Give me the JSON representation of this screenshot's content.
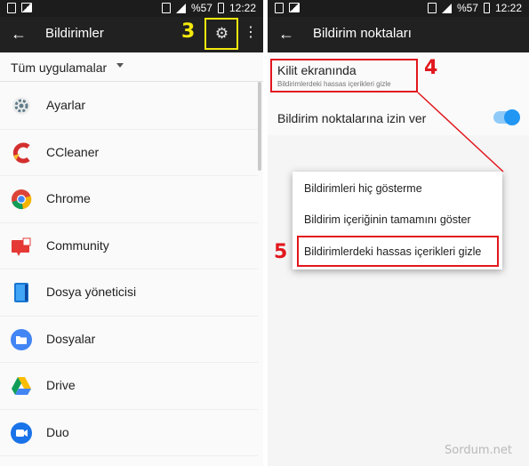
{
  "status": {
    "battery": "%57",
    "time": "12:22"
  },
  "left": {
    "title": "Bildirimler",
    "step_number": "3",
    "filter_label": "Tüm uygulamalar",
    "apps": [
      {
        "name": "Ayarlar",
        "icon": "settings-gear-icon"
      },
      {
        "name": "CCleaner",
        "icon": "ccleaner-icon"
      },
      {
        "name": "Chrome",
        "icon": "chrome-icon"
      },
      {
        "name": "Community",
        "icon": "community-icon"
      },
      {
        "name": "Dosya yöneticisi",
        "icon": "file-manager-icon"
      },
      {
        "name": "Dosyalar",
        "icon": "folder-icon"
      },
      {
        "name": "Drive",
        "icon": "drive-icon"
      },
      {
        "name": "Duo",
        "icon": "duo-icon"
      }
    ]
  },
  "right": {
    "title": "Bildirim noktaları",
    "lock_title": "Kilit ekranında",
    "lock_subtitle": "Bildirimlerdeki hassas içerikleri gizle",
    "dots_label": "Bildirim noktalarına izin ver",
    "toggle_on": true,
    "step4": "4",
    "step5": "5",
    "menu": [
      "Bildirimleri hiç gösterme",
      "Bildirim içeriğinin tamamını göster",
      "Bildirimlerdeki hassas içerikleri gizle"
    ]
  },
  "watermark": "Sordum.net",
  "colors": {
    "annotation_yellow": "#f4e90d",
    "annotation_red": "#e1171d",
    "toggle_blue": "#2196f3",
    "appbar": "#212121"
  }
}
